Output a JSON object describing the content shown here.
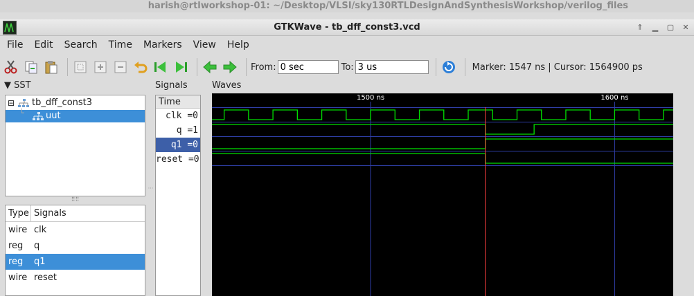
{
  "desktop": {
    "title": "harish@rtlworkshop-01: ~/Desktop/VLSI/sky130RTLDesignAndSynthesisWorkshop/verilog_files"
  },
  "window": {
    "title": "GTKWave - tb_dff_const3.vcd",
    "icon": "gtkwave-app-icon"
  },
  "menu": [
    "File",
    "Edit",
    "Search",
    "Time",
    "Markers",
    "View",
    "Help"
  ],
  "toolbar": {
    "from_label": "From:",
    "from_value": "0 sec",
    "to_label": "To:",
    "to_value": "3 us",
    "status": "Marker: 1547 ns  |  Cursor: 1564900 ps"
  },
  "sst": {
    "title": "SST",
    "tree": [
      {
        "label": "tb_dff_const3",
        "selected": false
      },
      {
        "label": "uut",
        "selected": true
      }
    ],
    "columns": [
      "Type",
      "Signals"
    ],
    "rows": [
      {
        "type": "wire",
        "name": "clk",
        "selected": false
      },
      {
        "type": "reg",
        "name": "q",
        "selected": false
      },
      {
        "type": "reg",
        "name": "q1",
        "selected": true
      },
      {
        "type": "wire",
        "name": "reset",
        "selected": false
      }
    ]
  },
  "signals": {
    "title": "Signals",
    "time_header": "Time",
    "items": [
      {
        "label": "clk =0",
        "selected": false
      },
      {
        "label": "q =1",
        "selected": false
      },
      {
        "label": "q1 =0",
        "selected": true
      },
      {
        "label": "reset =0",
        "selected": false
      }
    ]
  },
  "waves": {
    "title": "Waves",
    "ruler_labels": [
      {
        "text": "1500 ns",
        "time_ns": 1500
      },
      {
        "text": "1600 ns",
        "time_ns": 1600
      }
    ],
    "view_start_ns": 1435,
    "view_end_ns": 1624,
    "marker_ns": 1547,
    "clk_period_ns": 20,
    "clk_first_rise_ns": 1440,
    "q": [
      {
        "t": 1435,
        "v": 1
      },
      {
        "t": 1547,
        "v": 0
      },
      {
        "t": 1567,
        "v": 1
      }
    ],
    "q1": [
      {
        "t": 1435,
        "v": 0
      },
      {
        "t": 1547,
        "v": 1
      }
    ],
    "reset": [
      {
        "t": 1435,
        "v": 1
      },
      {
        "t": 1547,
        "v": 0
      }
    ],
    "colors": {
      "wave": "#00e000",
      "grid": "#2f3fa8",
      "marker": "#ff4040",
      "ruler_text": "#ffffff"
    }
  }
}
